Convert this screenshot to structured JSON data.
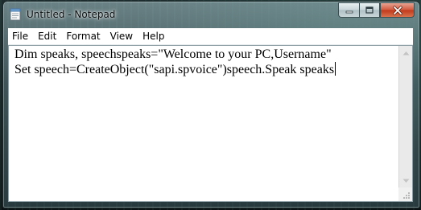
{
  "window": {
    "title": "Untitled - Notepad"
  },
  "menu": [
    {
      "label": "File"
    },
    {
      "label": "Edit"
    },
    {
      "label": "Format"
    },
    {
      "label": "View"
    },
    {
      "label": "Help"
    }
  ],
  "editor": {
    "lines": [
      "Dim speaks, speechspeaks=\"Welcome to your PC,Username\"",
      "Set speech=CreateObject(\"sapi.spvoice\")speech.Speak speaks"
    ]
  },
  "icons": {
    "app": "notepad-icon",
    "minimize": "minimize-icon",
    "maximize": "maximize-icon",
    "close": "close-icon",
    "scroll_up": "scroll-up-arrow-icon",
    "scroll_down": "scroll-down-arrow-icon",
    "resize": "resize-grip-icon"
  },
  "colors": {
    "close_button": "#c8401f",
    "editor_background": "#ffffff"
  }
}
